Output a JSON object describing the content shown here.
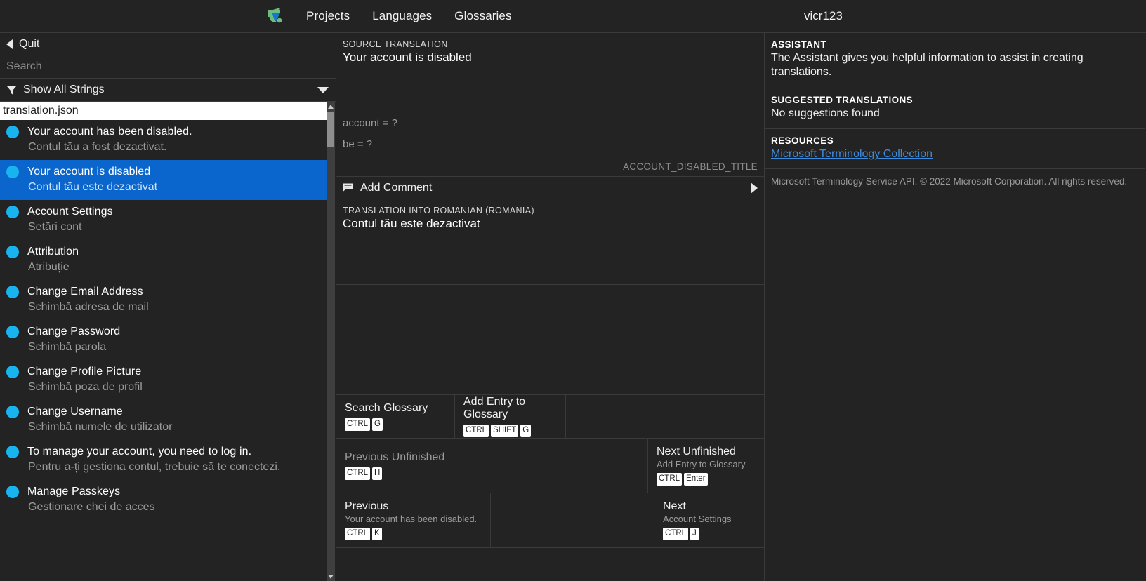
{
  "header": {
    "logo_icon": "voltra-flag-logo",
    "nav": [
      {
        "label": "Projects"
      },
      {
        "label": "Languages"
      },
      {
        "label": "Glossaries"
      }
    ],
    "username": "vicr123"
  },
  "sidebar": {
    "quit": {
      "label": "Quit",
      "icon": "back-arrow-icon"
    },
    "search": {
      "value": "",
      "placeholder": "Search"
    },
    "filter": {
      "label": "Show All Strings",
      "icon": "funnel-icon",
      "chevron": "chevron-down-icon"
    },
    "file": {
      "name": "translation.json"
    },
    "strings": [
      {
        "source": "Your account has been disabled.",
        "target": "Contul tău a fost dezactivat.",
        "selected": false
      },
      {
        "source": "Your account is disabled",
        "target": "Contul tău este dezactivat",
        "selected": true
      },
      {
        "source": "Account Settings",
        "target": "Setări cont",
        "selected": false
      },
      {
        "source": "Attribution",
        "target": "Atribuție",
        "selected": false
      },
      {
        "source": "Change Email Address",
        "target": "Schimbă adresa de mail",
        "selected": false
      },
      {
        "source": "Change Password",
        "target": "Schimbă parola",
        "selected": false
      },
      {
        "source": "Change Profile Picture",
        "target": "Schimbă poza de profil",
        "selected": false
      },
      {
        "source": "Change Username",
        "target": "Schimbă numele de utilizator",
        "selected": false
      },
      {
        "source": "To manage your account, you need to log in.",
        "target": "Pentru a-ți gestiona contul, trebuie să te conectezi.",
        "selected": false
      },
      {
        "source": "Manage Passkeys",
        "target": "Gestionare chei de acces",
        "selected": false
      }
    ]
  },
  "editor": {
    "source_caption": "SOURCE TRANSLATION",
    "source_text": "Your account is disabled",
    "glossary_hints": [
      {
        "text": "account = ?"
      },
      {
        "text": "be = ?"
      }
    ],
    "string_key": "ACCOUNT_DISABLED_TITLE",
    "comment": {
      "label": "Add Comment",
      "icon": "comment-icon",
      "expand_icon": "triangle-right-icon"
    },
    "translation_caption": "TRANSLATION INTO ROMANIAN (ROMANIA)",
    "translation_text": "Contul tău este dezactivat",
    "actions": {
      "search_glossary": {
        "title": "Search Glossary",
        "keys": [
          "CTRL",
          "G"
        ]
      },
      "add_entry_to_glossary": {
        "title": "Add Entry to Glossary",
        "keys": [
          "CTRL",
          "SHIFT",
          "G"
        ]
      },
      "previous_unfinished": {
        "title": "Previous Unfinished",
        "keys": [
          "CTRL",
          "H"
        ]
      },
      "next_unfinished": {
        "title": "Next Unfinished",
        "subtitle": "Add Entry to Glossary",
        "keys": [
          "CTRL",
          "Enter"
        ]
      },
      "previous": {
        "title": "Previous",
        "subtitle": "Your account has been disabled.",
        "keys": [
          "CTRL",
          "K"
        ]
      },
      "next": {
        "title": "Next",
        "subtitle": "Account Settings",
        "keys": [
          "CTRL",
          "J"
        ]
      }
    }
  },
  "assistant": {
    "title": "ASSISTANT",
    "description": "The Assistant gives you helpful information to assist in creating translations.",
    "suggested_title": "SUGGESTED TRANSLATIONS",
    "suggested_body": "No suggestions found",
    "resources_title": "RESOURCES",
    "resource_link": "Microsoft Terminology Collection",
    "footer": "Microsoft Terminology Service API. © 2022 Microsoft Corporation. All rights reserved."
  },
  "colors": {
    "background": "#232323",
    "selection": "#0a66cc",
    "dot": "#18b4f0",
    "link": "#3d8bdd",
    "logo_green": "#6ebd7e",
    "logo_blue": "#1079cc"
  }
}
